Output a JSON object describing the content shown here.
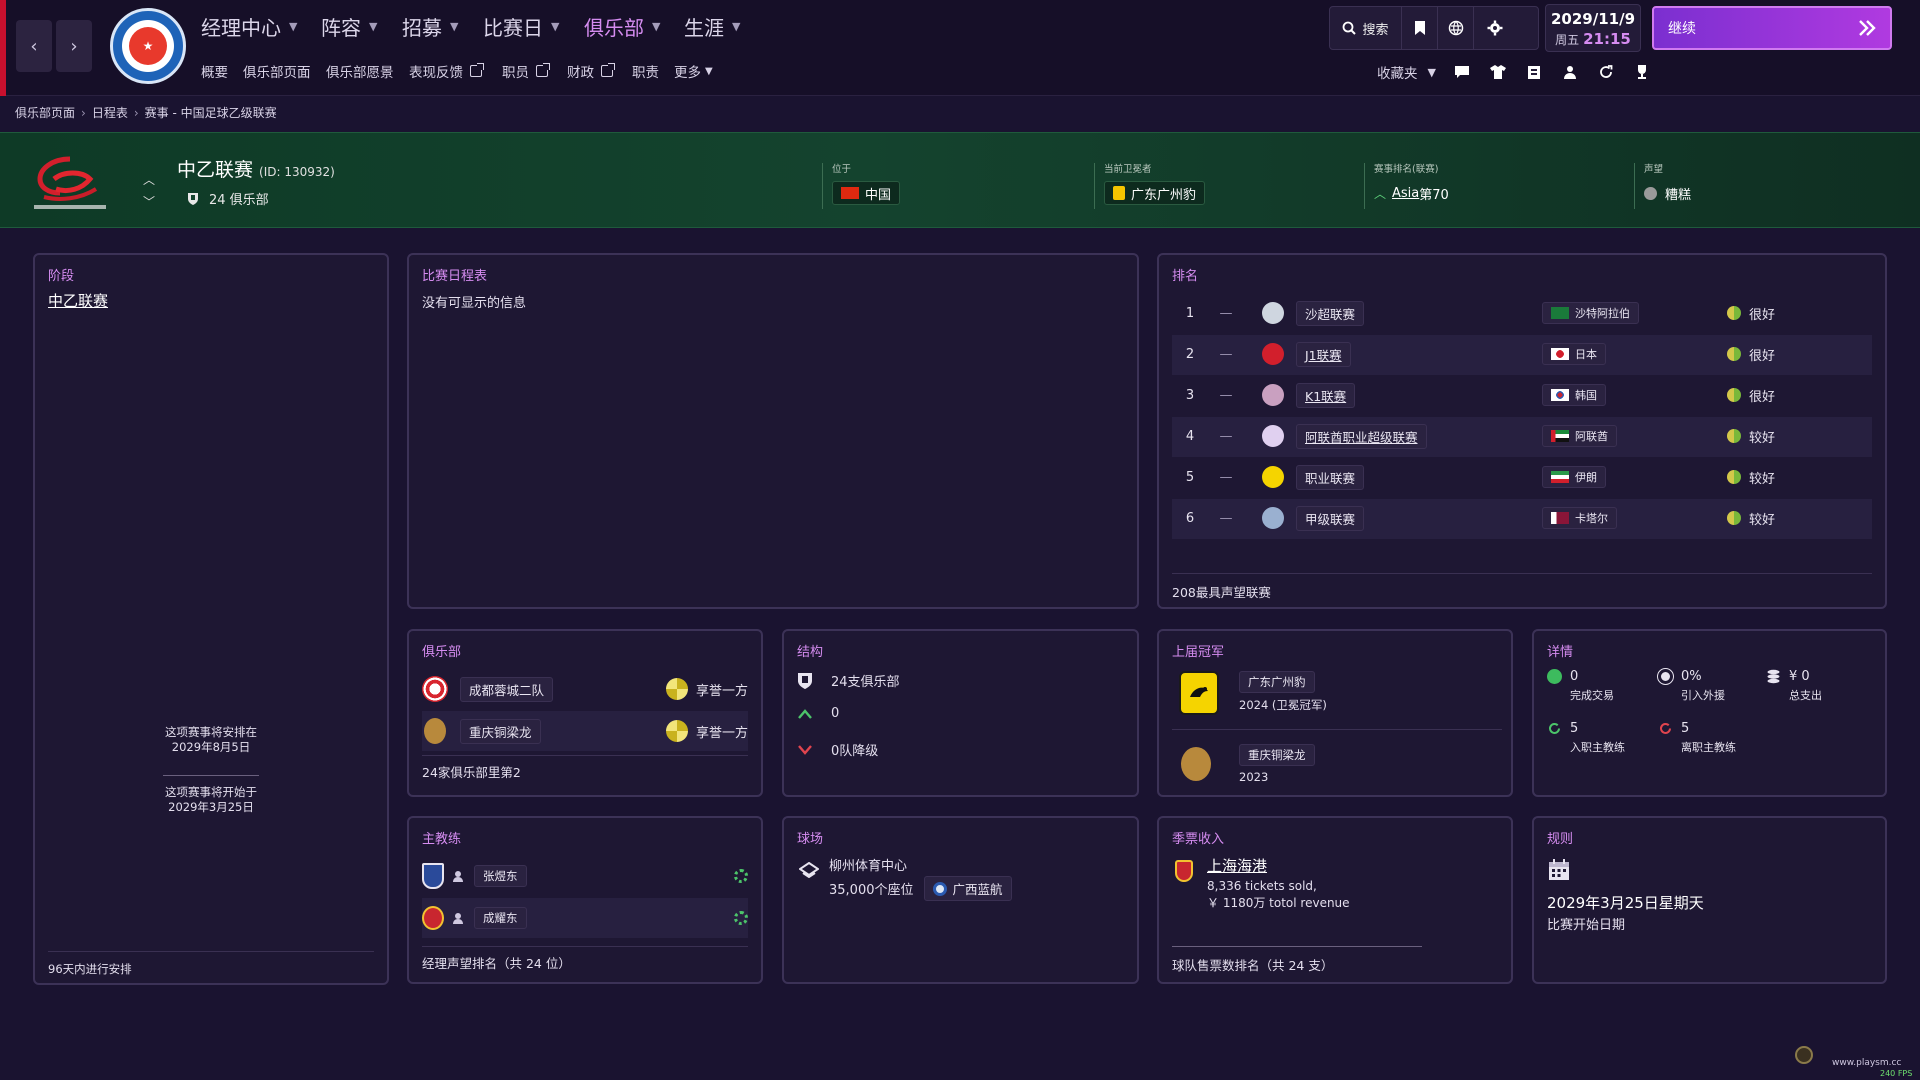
{
  "nav": {
    "back": "‹",
    "forward": "›",
    "menus": [
      "经理中心",
      "阵容",
      "招募",
      "比赛日",
      "俱乐部",
      "生涯"
    ],
    "submenus": [
      "概要",
      "俱乐部页面",
      "俱乐部愿景",
      "表现反馈",
      "职员",
      "财政",
      "职责",
      "更多"
    ],
    "search_label": "搜索",
    "date": "2029/11/9",
    "weekday": "周五",
    "time": "21:15",
    "continue_label": "继续",
    "favorites_label": "收藏夹"
  },
  "breadcrumb": [
    "俱乐部页面",
    "日程表",
    "赛事 - 中国足球乙级联赛"
  ],
  "header": {
    "competition": "中乙联赛",
    "id_text": "(ID: 130932)",
    "clubs_text": "24 俱乐部",
    "location_label": "位于",
    "location_value": "中国",
    "defender_label": "当前卫冕者",
    "defender_value": "广东广州豹",
    "rank_label": "赛事排名(联赛)",
    "rank_region": "Asia",
    "rank_value": "第70",
    "reputation_label": "声望",
    "reputation_value": "糟糕"
  },
  "stage": {
    "title": "阶段",
    "value": "中乙联赛",
    "end_note_1": "这项赛事将安排在",
    "end_note_2": "2029年8月5日",
    "start_note_1": "这项赛事将开始于",
    "start_note_2": "2029年3月25日",
    "footer": "96天内进行安排"
  },
  "schedule": {
    "title": "比赛日程表",
    "empty": "没有可显示的信息"
  },
  "ranking": {
    "title": "排名",
    "rows": [
      {
        "pos": "1",
        "move": "—",
        "name": "沙超联赛",
        "nation": "沙特阿拉伯",
        "rep": "很好",
        "link": false
      },
      {
        "pos": "2",
        "move": "—",
        "name": "J1联赛",
        "nation": "日本",
        "rep": "很好",
        "link": true
      },
      {
        "pos": "3",
        "move": "—",
        "name": "K1联赛",
        "nation": "韩国",
        "rep": "很好",
        "link": true
      },
      {
        "pos": "4",
        "move": "—",
        "name": "阿联酋职业超级联赛",
        "nation": "阿联酋",
        "rep": "较好",
        "link": true
      },
      {
        "pos": "5",
        "move": "—",
        "name": "职业联赛",
        "nation": "伊朗",
        "rep": "较好",
        "link": false
      },
      {
        "pos": "6",
        "move": "—",
        "name": "甲级联赛",
        "nation": "卡塔尔",
        "rep": "较好",
        "link": false
      }
    ],
    "footer": "208最具声望联赛"
  },
  "clubs": {
    "title": "俱乐部",
    "rows": [
      {
        "name": "成都蓉城二队",
        "status": "享誉一方"
      },
      {
        "name": "重庆铜梁龙",
        "status": "享誉一方"
      }
    ],
    "footer": "24家俱乐部里第2"
  },
  "structure": {
    "title": "结构",
    "clubs": "24支俱乐部",
    "promoted": "0",
    "relegated": "0队降级"
  },
  "champions": {
    "title": "上届冠军",
    "rows": [
      {
        "name": "广东广州豹",
        "note": "2024 (卫冕冠军)"
      },
      {
        "name": "重庆铜梁龙",
        "note": "2023"
      }
    ]
  },
  "details": {
    "title": "详情",
    "items": [
      {
        "value": "0",
        "label": "完成交易"
      },
      {
        "value": "0%",
        "label": "引入外援"
      },
      {
        "value": "¥ 0",
        "label": "总支出"
      },
      {
        "value": "5",
        "label": "入职主教练"
      },
      {
        "value": "5",
        "label": "离职主教练"
      }
    ]
  },
  "managers": {
    "title": "主教练",
    "rows": [
      {
        "name": "张煜东"
      },
      {
        "name": "成耀东"
      }
    ],
    "footer": "经理声望排名（共 24 位）"
  },
  "stadium": {
    "title": "球场",
    "name": "柳州体育中心",
    "capacity": "35,000个座位",
    "club": "广西蓝航"
  },
  "tickets": {
    "title": "季票收入",
    "club": "上海海港",
    "sold": "8,336 tickets sold,",
    "revenue": "￥ 1180万 totol revenue",
    "footer": "球队售票数排名（共 24 支）"
  },
  "rules": {
    "title": "规则",
    "date": "2029年3月25日星期天",
    "label": "比赛开始日期"
  },
  "watermark": "www.playsm.cc",
  "fps": "240 FPS",
  "colors": {
    "accent": "#d58cf0",
    "band": "#14432e",
    "panel": "#1e1733",
    "continue": "#b03ae0"
  }
}
